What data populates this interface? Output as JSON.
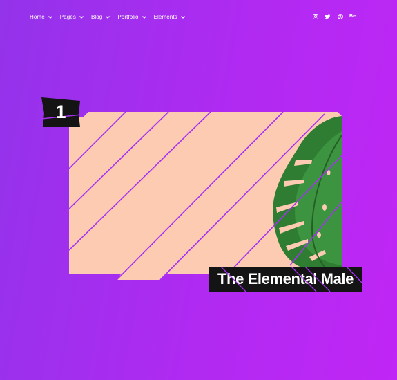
{
  "nav": {
    "items": [
      {
        "label": "Home"
      },
      {
        "label": "Pages"
      },
      {
        "label": "Blog"
      },
      {
        "label": "Portfolio"
      },
      {
        "label": "Elements"
      }
    ],
    "social": [
      {
        "icon": "instagram-icon"
      },
      {
        "icon": "twitter-icon"
      },
      {
        "icon": "dribbble-icon"
      },
      {
        "icon": "behance-icon",
        "label": "Be"
      }
    ]
  },
  "slide": {
    "number": "1",
    "title": "The Elemental Male"
  },
  "colors": {
    "background_start": "#9333ea",
    "background_end": "#c026f5",
    "card": "#fdcbb2",
    "label_bg": "#141414",
    "leaf": "#2e7d32"
  }
}
